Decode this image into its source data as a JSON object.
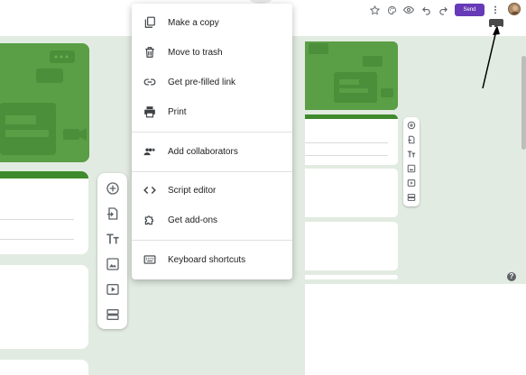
{
  "topbar": {
    "send_label": "Send",
    "icons": [
      "customize-theme-icon",
      "palette-icon",
      "preview-eye-icon",
      "undo-icon",
      "redo-icon",
      "more-vert-icon"
    ]
  },
  "menu": {
    "items": [
      {
        "label": "Make a copy",
        "icon": "copy-icon"
      },
      {
        "label": "Move to trash",
        "icon": "trash-icon"
      },
      {
        "label": "Get pre-filled link",
        "icon": "link-icon"
      },
      {
        "label": "Print",
        "icon": "print-icon"
      },
      {
        "label": "Add collaborators",
        "icon": "add-people-icon"
      },
      {
        "label": "Script editor",
        "icon": "code-icon"
      },
      {
        "label": "Get add-ons",
        "icon": "puzzle-icon"
      },
      {
        "label": "Keyboard shortcuts",
        "icon": "keyboard-icon"
      }
    ]
  },
  "toolbar": {
    "tools": [
      "add-question-icon",
      "import-questions-icon",
      "add-title-icon",
      "add-image-icon",
      "add-video-icon",
      "add-section-icon"
    ]
  },
  "help": {
    "label": "?"
  },
  "colors": {
    "accent": "#673ab7",
    "banner": "#5a9e45",
    "card_border": "#3e8a2c",
    "form_bg": "#e2ebe1"
  }
}
